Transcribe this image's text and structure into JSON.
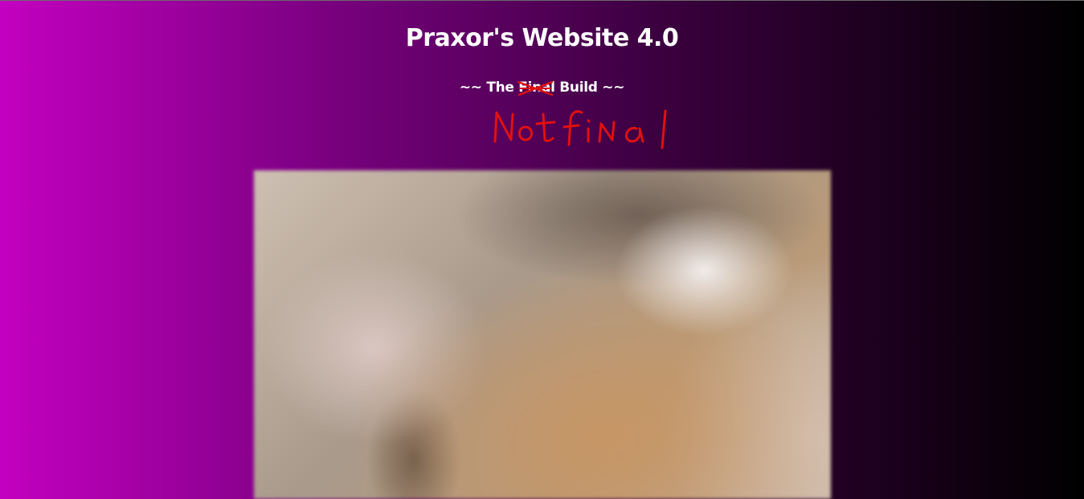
{
  "header": {
    "title": "Praxor's Website 4.0",
    "subtitle_prefix": "~~ The ",
    "subtitle_struck": "Final",
    "subtitle_suffix": " Build ~~",
    "handwritten_note": "Not final"
  },
  "colors": {
    "gradient_start": "#c300c0",
    "gradient_end": "#000000",
    "annotation": "#e01010",
    "text": "#ffffff"
  },
  "images": {
    "main_photo": "blurred photo"
  }
}
